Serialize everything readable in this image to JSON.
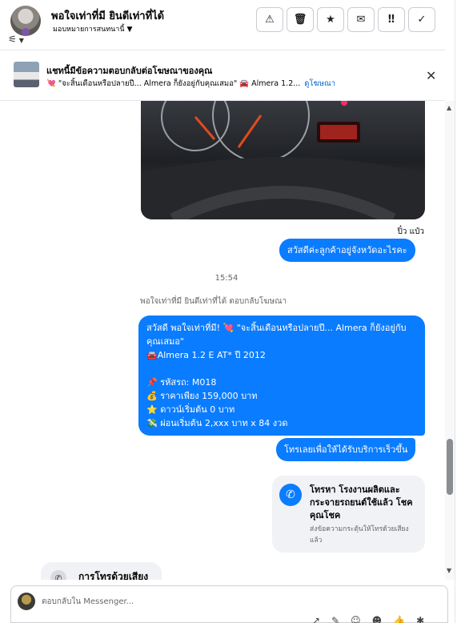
{
  "header": {
    "title": "พอใจเท่าที่มี ยินดีเท่าที่ได้",
    "assignee": "มอบหมายการสนทนานี้",
    "actions": [
      "mark-spam",
      "delete",
      "star",
      "mark-unread",
      "priority",
      "done"
    ]
  },
  "ad_banner": {
    "title": "แชทนี้มีข้อความตอบกลับต่อโฆษณาของคุณ",
    "subtitle": "💘 \"จะสิ้นเดือนหรือปลายปี... Almera ก็ยังอยู่กับคุณเสมอ\" 🚘 Almera 1.2...",
    "link": "ดูโฆษณา"
  },
  "messages": {
    "reaction_name": "ปิ๋ว แป๋ว",
    "greeting": "สวัสดีค่ะลูกค้าอยู่จังหวัดอะไรคะ",
    "timestamp": "15:54",
    "replied_note": "พอใจเท่าที่มี ยินดีเท่าที่ได้ ตอบกลับโฆษณา",
    "ad_reply_lines": [
      "สวัสดี พอใจเท่าที่มี! 💘 \"จะสิ้นเดือนหรือปลายปี... Almera ก็ยังอยู่กับคุณเสมอ\"",
      "🚘Almera 1.2 E AT* ปี 2012",
      "",
      "📌 รหัสรถ: M018",
      "💰 ราคาเพียง 159,000 บาท",
      "⭐ ดาวน์เริ่มต้น 0 บาท",
      "💸 ผ่อนเริ่มต้น 2,xxx บาท x 84 งวด"
    ],
    "call_prompt": "โทรเลยเพื่อให้ได้รับบริการเร็วขึ้น",
    "call_card": {
      "title": "โทรหา โรงงานผลิตและกระจายรถยนต์ใช้แล้ว โชคคุณโชค",
      "subtitle": "ส่งข้อความกระตุ้นให้โทรด้วยเสียงแล้ว"
    },
    "voice_call_label": "การโทรด้วยเสียง"
  },
  "composer": {
    "placeholder": "ตอบกลับใน Messenger..."
  },
  "colors": {
    "bubble_blue": "#0a7cff",
    "link_blue": "#0064d1",
    "card_gray": "#f0f2f5"
  }
}
